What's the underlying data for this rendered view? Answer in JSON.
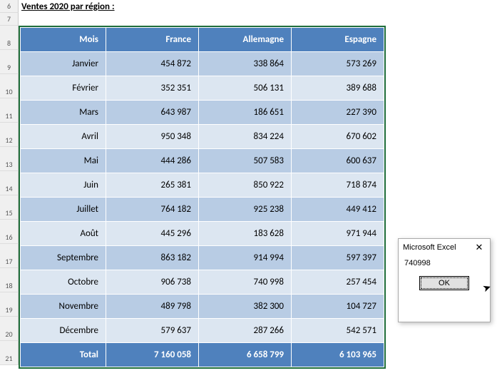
{
  "title": "Ventes 2020 par région :",
  "row_numbers": [
    "6",
    "7",
    "8",
    "9",
    "10",
    "11",
    "12",
    "13",
    "14",
    "15",
    "16",
    "17",
    "18",
    "19",
    "20",
    "21"
  ],
  "columns": [
    "Mois",
    "France",
    "Allemagne",
    "Espagne"
  ],
  "rows": [
    {
      "mois": "Janvier",
      "fr": "454 872",
      "de": "338 864",
      "es": "573 269"
    },
    {
      "mois": "Février",
      "fr": "352 351",
      "de": "506 131",
      "es": "389 688"
    },
    {
      "mois": "Mars",
      "fr": "643 987",
      "de": "186 651",
      "es": "227 390"
    },
    {
      "mois": "Avril",
      "fr": "950 348",
      "de": "834 224",
      "es": "670 602"
    },
    {
      "mois": "Mai",
      "fr": "444 286",
      "de": "507 583",
      "es": "600 637"
    },
    {
      "mois": "Juin",
      "fr": "265 381",
      "de": "850 922",
      "es": "718 874"
    },
    {
      "mois": "Juillet",
      "fr": "764 182",
      "de": "925 238",
      "es": "449 412"
    },
    {
      "mois": "Août",
      "fr": "445 296",
      "de": "183 628",
      "es": "971 944"
    },
    {
      "mois": "Septembre",
      "fr": "863 182",
      "de": "914 994",
      "es": "597 397"
    },
    {
      "mois": "Octobre",
      "fr": "906 738",
      "de": "740 998",
      "es": "257 454"
    },
    {
      "mois": "Novembre",
      "fr": "489 798",
      "de": "382 300",
      "es": "104 727"
    },
    {
      "mois": "Décembre",
      "fr": "579 637",
      "de": "287 266",
      "es": "542 571"
    }
  ],
  "total": {
    "label": "Total",
    "fr": "7 160 058",
    "de": "6 658 799",
    "es": "6 103 965"
  },
  "dialog": {
    "title": "Microsoft Excel",
    "message": "740998",
    "ok_label": "OK"
  },
  "chart_data": {
    "type": "table",
    "title": "Ventes 2020 par région",
    "columns": [
      "Mois",
      "France",
      "Allemagne",
      "Espagne"
    ],
    "rows": [
      [
        "Janvier",
        454872,
        338864,
        573269
      ],
      [
        "Février",
        352351,
        506131,
        389688
      ],
      [
        "Mars",
        643987,
        186651,
        227390
      ],
      [
        "Avril",
        950348,
        834224,
        670602
      ],
      [
        "Mai",
        444286,
        507583,
        600637
      ],
      [
        "Juin",
        265381,
        850922,
        718874
      ],
      [
        "Juillet",
        764182,
        925238,
        449412
      ],
      [
        "Août",
        445296,
        183628,
        971944
      ],
      [
        "Septembre",
        863182,
        914994,
        597397
      ],
      [
        "Octobre",
        906738,
        740998,
        257454
      ],
      [
        "Novembre",
        489798,
        382300,
        104727
      ],
      [
        "Décembre",
        579637,
        287266,
        542571
      ],
      [
        "Total",
        7160058,
        6658799,
        6103965
      ]
    ]
  }
}
